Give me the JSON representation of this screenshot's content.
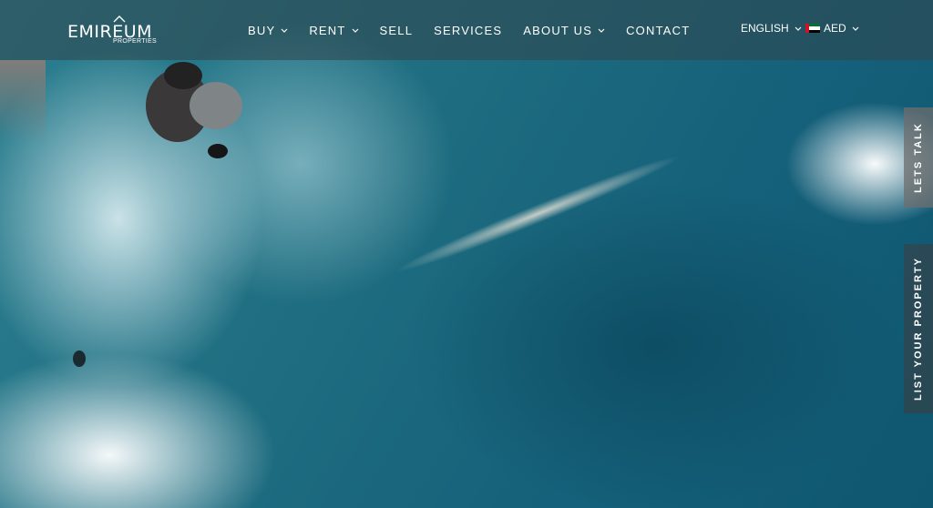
{
  "logo": {
    "name": "EMIREUM",
    "sub": "PROPERTIES"
  },
  "nav": {
    "items": [
      {
        "label": "BUY",
        "dropdown": true
      },
      {
        "label": "RENT",
        "dropdown": true
      },
      {
        "label": "SELL",
        "dropdown": false
      },
      {
        "label": "SERVICES",
        "dropdown": false
      },
      {
        "label": "ABOUT US",
        "dropdown": true
      },
      {
        "label": "CONTACT",
        "dropdown": false
      }
    ]
  },
  "language": {
    "selected": "ENGLISH"
  },
  "currency": {
    "selected": "AED",
    "flag": "uae-flag-icon"
  },
  "side_tabs": {
    "talk": "LETS TALK",
    "list": "LIST YOUR PROPERTY"
  },
  "colors": {
    "flag_red": "#ce1126",
    "flag_green": "#00732f",
    "flag_white": "#ffffff",
    "flag_black": "#000000"
  }
}
